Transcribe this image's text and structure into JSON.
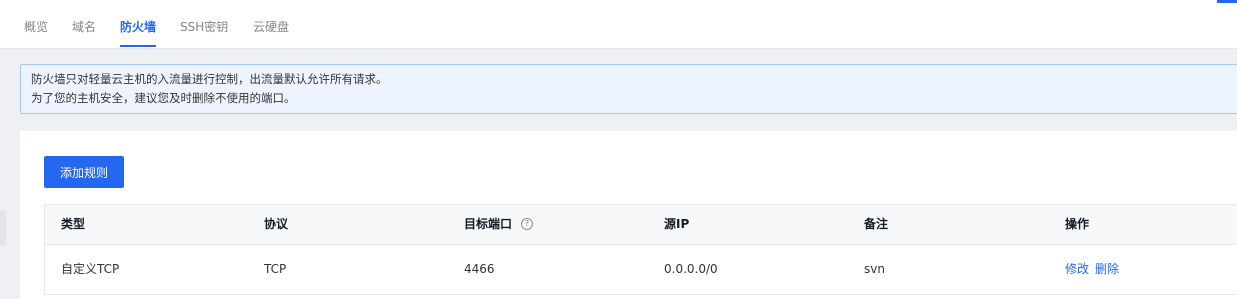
{
  "tabs": [
    {
      "label": "概览",
      "active": false
    },
    {
      "label": "域名",
      "active": false
    },
    {
      "label": "防火墙",
      "active": true
    },
    {
      "label": "SSH密钥",
      "active": false
    },
    {
      "label": "云硬盘",
      "active": false
    }
  ],
  "notice": {
    "line1": "防火墙只对轻量云主机的入流量进行控制，出流量默认允许所有请求。",
    "line2": "为了您的主机安全，建议您及时删除不使用的端口。"
  },
  "toolbar": {
    "add_rule_label": "添加规则"
  },
  "table": {
    "headers": {
      "type": "类型",
      "protocol": "协议",
      "target_port": "目标端口",
      "source_ip": "源IP",
      "remark": "备注",
      "actions": "操作"
    },
    "help_icon": "question-circle-icon",
    "rows": [
      {
        "type": "自定义TCP",
        "protocol": "TCP",
        "target_port": "4466",
        "source_ip": "0.0.0.0/0",
        "remark": "svn",
        "edit_label": "修改",
        "delete_label": "删除"
      }
    ]
  },
  "colors": {
    "accent": "#2468f2",
    "notice_bg": "#eef4ff",
    "notice_border": "#a8c6f7",
    "page_bg": "#eef0f3"
  }
}
